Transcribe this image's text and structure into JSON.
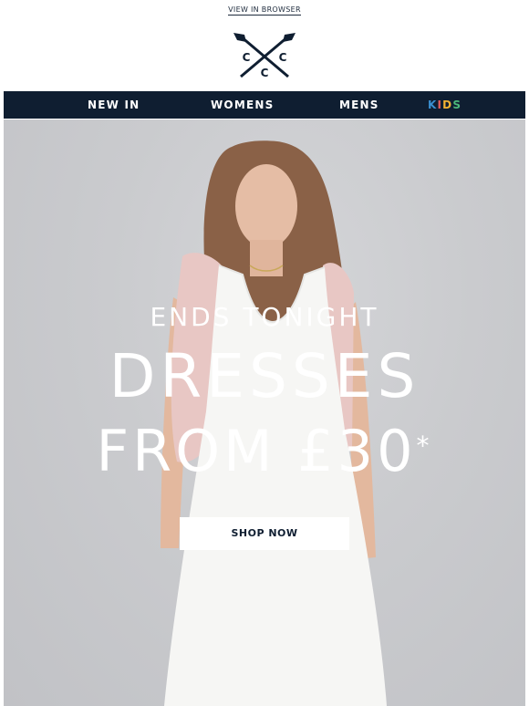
{
  "header": {
    "view_in_browser": "VIEW IN BROWSER",
    "logo_letters": [
      "C",
      "C",
      "C"
    ]
  },
  "nav": {
    "items": [
      {
        "label": "NEW IN"
      },
      {
        "label": "WOMENS"
      },
      {
        "label": "MENS"
      },
      {
        "label": "KIDS",
        "letter_colors": [
          "#3a8fd0",
          "#e25d5d",
          "#f2b233",
          "#4cb87a"
        ]
      }
    ]
  },
  "hero": {
    "subheading": "ENDS TONIGHT",
    "heading_line1": "DRESSES",
    "heading_line2": "FROM £30",
    "asterisk": "*",
    "cta_label": "SHOP NOW"
  },
  "colors": {
    "navy": "#0f1e31",
    "hero_bg": "#c9cacd",
    "white": "#ffffff"
  }
}
